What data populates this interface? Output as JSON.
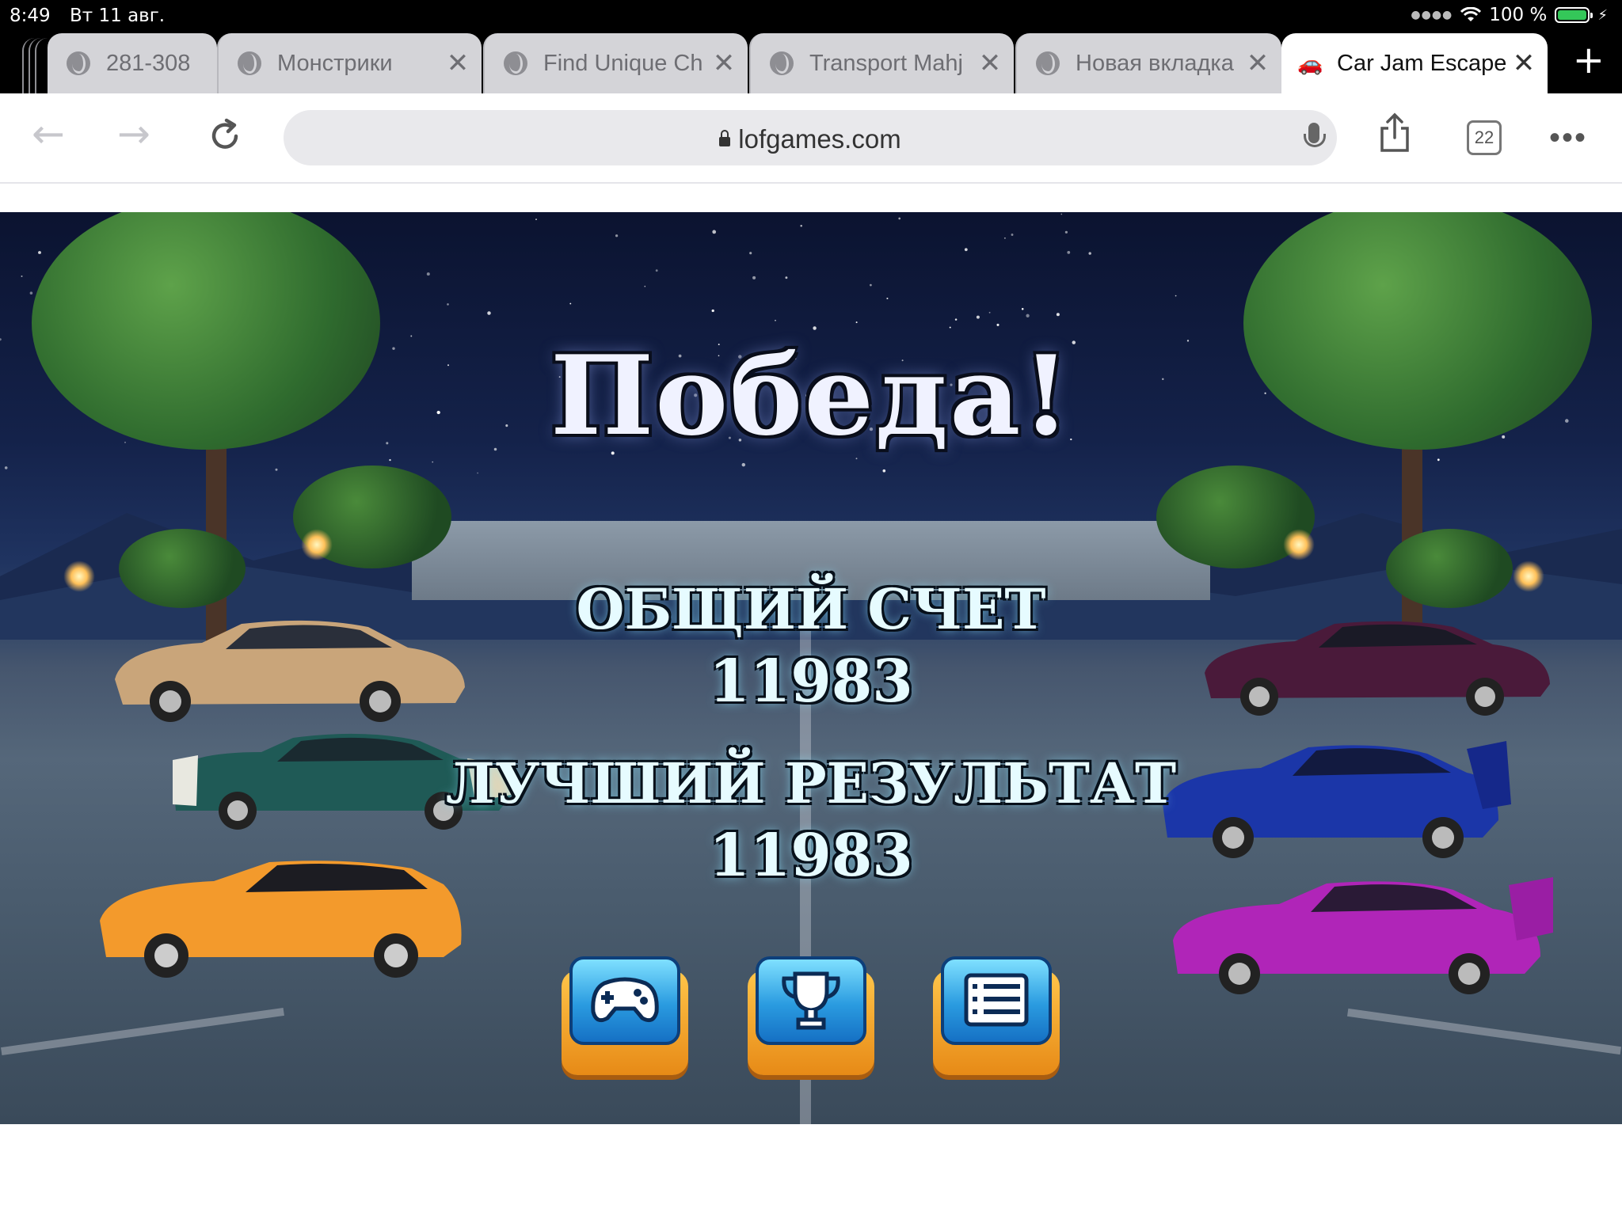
{
  "status_bar": {
    "time": "8:49",
    "date": "Вт 11 авг.",
    "battery": "100 %",
    "battery_level": 1.0
  },
  "tabs": [
    {
      "title": "281-308",
      "icon": "globe-icon",
      "closable": false,
      "active": false
    },
    {
      "title": "Монстрики",
      "icon": "globe-icon",
      "closable": true,
      "active": false
    },
    {
      "title": "Find Unique Ch",
      "icon": "globe-icon",
      "closable": true,
      "active": false
    },
    {
      "title": "Transport Mahj",
      "icon": "globe-icon",
      "closable": true,
      "active": false
    },
    {
      "title": "Новая вкладка",
      "icon": "globe-icon",
      "closable": true,
      "active": false
    },
    {
      "title": "Car Jam Escape",
      "icon": "car-favicon-icon",
      "closable": true,
      "active": true
    }
  ],
  "toolbar": {
    "url": "lofgames.com",
    "tab_count": "22"
  },
  "game": {
    "title": "Победа!",
    "total_score_label": "ОБЩИЙ СЧЕТ",
    "total_score": "11983",
    "best_result_label": "ЛУЧШИЙ РЕЗУЛЬТАТ",
    "best_result": "11983",
    "buttons": [
      {
        "icon": "gamepad-icon"
      },
      {
        "icon": "trophy-icon"
      },
      {
        "icon": "menu-list-icon"
      }
    ]
  },
  "colors": {
    "car_gold": "#c9a57a",
    "car_teal": "#1f5a56",
    "car_orange": "#f39a2c",
    "car_maroon": "#4a1a3a",
    "car_blue": "#1b36a8",
    "car_purple": "#b025b8",
    "button_face": "#2a9be0",
    "button_base": "#f0a020"
  }
}
